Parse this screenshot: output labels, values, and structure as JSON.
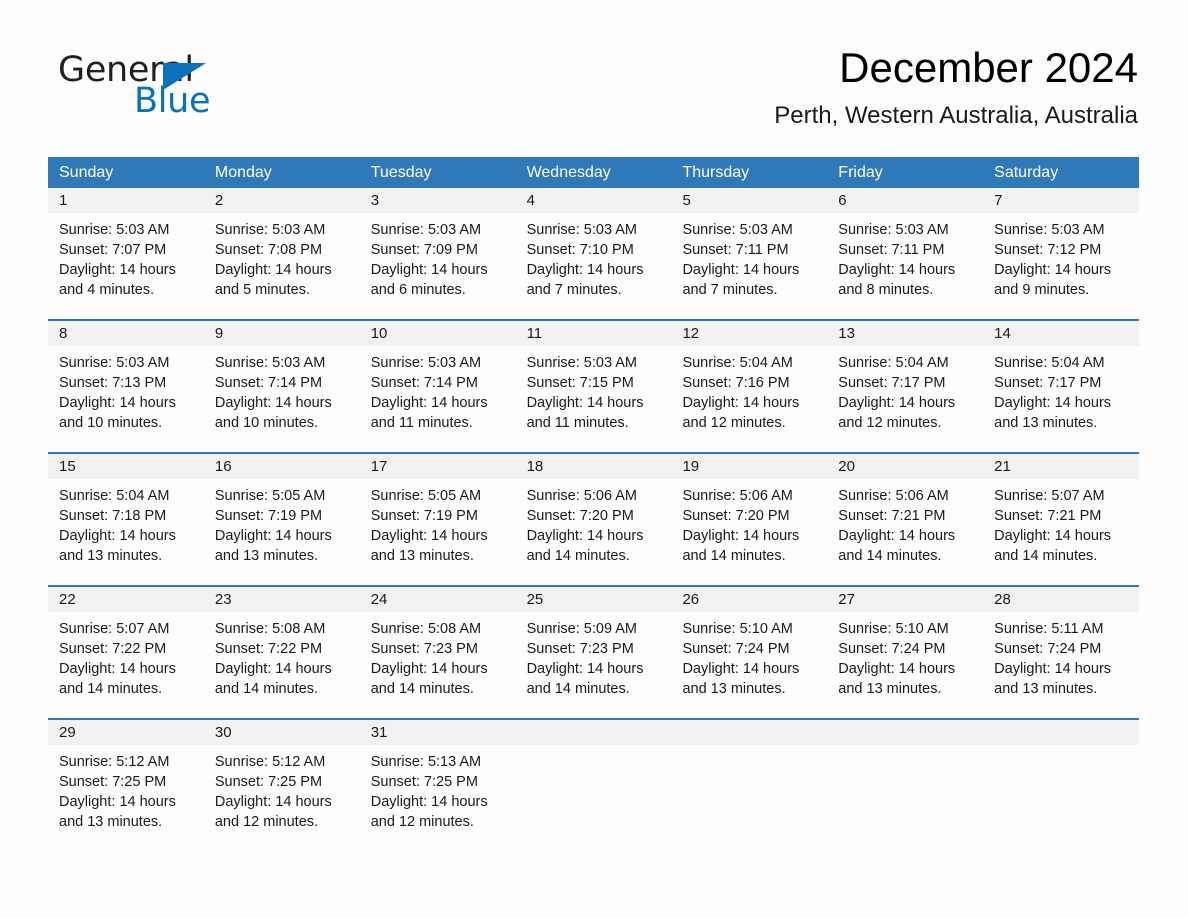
{
  "brand": {
    "name_part1": "General",
    "name_part2": "Blue",
    "triangle_color": "#0a72ba"
  },
  "header": {
    "title": "December 2024",
    "location": "Perth, Western Australia, Australia",
    "accent_color": "#3079b9",
    "band_color": "#f2f2f2"
  },
  "weekdays": [
    "Sunday",
    "Monday",
    "Tuesday",
    "Wednesday",
    "Thursday",
    "Friday",
    "Saturday"
  ],
  "weeks": [
    [
      {
        "day": "1",
        "sunrise": "Sunrise: 5:03 AM",
        "sunset": "Sunset: 7:07 PM",
        "daylight_1": "Daylight: 14 hours",
        "daylight_2": "and 4 minutes."
      },
      {
        "day": "2",
        "sunrise": "Sunrise: 5:03 AM",
        "sunset": "Sunset: 7:08 PM",
        "daylight_1": "Daylight: 14 hours",
        "daylight_2": "and 5 minutes."
      },
      {
        "day": "3",
        "sunrise": "Sunrise: 5:03 AM",
        "sunset": "Sunset: 7:09 PM",
        "daylight_1": "Daylight: 14 hours",
        "daylight_2": "and 6 minutes."
      },
      {
        "day": "4",
        "sunrise": "Sunrise: 5:03 AM",
        "sunset": "Sunset: 7:10 PM",
        "daylight_1": "Daylight: 14 hours",
        "daylight_2": "and 7 minutes."
      },
      {
        "day": "5",
        "sunrise": "Sunrise: 5:03 AM",
        "sunset": "Sunset: 7:11 PM",
        "daylight_1": "Daylight: 14 hours",
        "daylight_2": "and 7 minutes."
      },
      {
        "day": "6",
        "sunrise": "Sunrise: 5:03 AM",
        "sunset": "Sunset: 7:11 PM",
        "daylight_1": "Daylight: 14 hours",
        "daylight_2": "and 8 minutes."
      },
      {
        "day": "7",
        "sunrise": "Sunrise: 5:03 AM",
        "sunset": "Sunset: 7:12 PM",
        "daylight_1": "Daylight: 14 hours",
        "daylight_2": "and 9 minutes."
      }
    ],
    [
      {
        "day": "8",
        "sunrise": "Sunrise: 5:03 AM",
        "sunset": "Sunset: 7:13 PM",
        "daylight_1": "Daylight: 14 hours",
        "daylight_2": "and 10 minutes."
      },
      {
        "day": "9",
        "sunrise": "Sunrise: 5:03 AM",
        "sunset": "Sunset: 7:14 PM",
        "daylight_1": "Daylight: 14 hours",
        "daylight_2": "and 10 minutes."
      },
      {
        "day": "10",
        "sunrise": "Sunrise: 5:03 AM",
        "sunset": "Sunset: 7:14 PM",
        "daylight_1": "Daylight: 14 hours",
        "daylight_2": "and 11 minutes."
      },
      {
        "day": "11",
        "sunrise": "Sunrise: 5:03 AM",
        "sunset": "Sunset: 7:15 PM",
        "daylight_1": "Daylight: 14 hours",
        "daylight_2": "and 11 minutes."
      },
      {
        "day": "12",
        "sunrise": "Sunrise: 5:04 AM",
        "sunset": "Sunset: 7:16 PM",
        "daylight_1": "Daylight: 14 hours",
        "daylight_2": "and 12 minutes."
      },
      {
        "day": "13",
        "sunrise": "Sunrise: 5:04 AM",
        "sunset": "Sunset: 7:17 PM",
        "daylight_1": "Daylight: 14 hours",
        "daylight_2": "and 12 minutes."
      },
      {
        "day": "14",
        "sunrise": "Sunrise: 5:04 AM",
        "sunset": "Sunset: 7:17 PM",
        "daylight_1": "Daylight: 14 hours",
        "daylight_2": "and 13 minutes."
      }
    ],
    [
      {
        "day": "15",
        "sunrise": "Sunrise: 5:04 AM",
        "sunset": "Sunset: 7:18 PM",
        "daylight_1": "Daylight: 14 hours",
        "daylight_2": "and 13 minutes."
      },
      {
        "day": "16",
        "sunrise": "Sunrise: 5:05 AM",
        "sunset": "Sunset: 7:19 PM",
        "daylight_1": "Daylight: 14 hours",
        "daylight_2": "and 13 minutes."
      },
      {
        "day": "17",
        "sunrise": "Sunrise: 5:05 AM",
        "sunset": "Sunset: 7:19 PM",
        "daylight_1": "Daylight: 14 hours",
        "daylight_2": "and 13 minutes."
      },
      {
        "day": "18",
        "sunrise": "Sunrise: 5:06 AM",
        "sunset": "Sunset: 7:20 PM",
        "daylight_1": "Daylight: 14 hours",
        "daylight_2": "and 14 minutes."
      },
      {
        "day": "19",
        "sunrise": "Sunrise: 5:06 AM",
        "sunset": "Sunset: 7:20 PM",
        "daylight_1": "Daylight: 14 hours",
        "daylight_2": "and 14 minutes."
      },
      {
        "day": "20",
        "sunrise": "Sunrise: 5:06 AM",
        "sunset": "Sunset: 7:21 PM",
        "daylight_1": "Daylight: 14 hours",
        "daylight_2": "and 14 minutes."
      },
      {
        "day": "21",
        "sunrise": "Sunrise: 5:07 AM",
        "sunset": "Sunset: 7:21 PM",
        "daylight_1": "Daylight: 14 hours",
        "daylight_2": "and 14 minutes."
      }
    ],
    [
      {
        "day": "22",
        "sunrise": "Sunrise: 5:07 AM",
        "sunset": "Sunset: 7:22 PM",
        "daylight_1": "Daylight: 14 hours",
        "daylight_2": "and 14 minutes."
      },
      {
        "day": "23",
        "sunrise": "Sunrise: 5:08 AM",
        "sunset": "Sunset: 7:22 PM",
        "daylight_1": "Daylight: 14 hours",
        "daylight_2": "and 14 minutes."
      },
      {
        "day": "24",
        "sunrise": "Sunrise: 5:08 AM",
        "sunset": "Sunset: 7:23 PM",
        "daylight_1": "Daylight: 14 hours",
        "daylight_2": "and 14 minutes."
      },
      {
        "day": "25",
        "sunrise": "Sunrise: 5:09 AM",
        "sunset": "Sunset: 7:23 PM",
        "daylight_1": "Daylight: 14 hours",
        "daylight_2": "and 14 minutes."
      },
      {
        "day": "26",
        "sunrise": "Sunrise: 5:10 AM",
        "sunset": "Sunset: 7:24 PM",
        "daylight_1": "Daylight: 14 hours",
        "daylight_2": "and 13 minutes."
      },
      {
        "day": "27",
        "sunrise": "Sunrise: 5:10 AM",
        "sunset": "Sunset: 7:24 PM",
        "daylight_1": "Daylight: 14 hours",
        "daylight_2": "and 13 minutes."
      },
      {
        "day": "28",
        "sunrise": "Sunrise: 5:11 AM",
        "sunset": "Sunset: 7:24 PM",
        "daylight_1": "Daylight: 14 hours",
        "daylight_2": "and 13 minutes."
      }
    ],
    [
      {
        "day": "29",
        "sunrise": "Sunrise: 5:12 AM",
        "sunset": "Sunset: 7:25 PM",
        "daylight_1": "Daylight: 14 hours",
        "daylight_2": "and 13 minutes."
      },
      {
        "day": "30",
        "sunrise": "Sunrise: 5:12 AM",
        "sunset": "Sunset: 7:25 PM",
        "daylight_1": "Daylight: 14 hours",
        "daylight_2": "and 12 minutes."
      },
      {
        "day": "31",
        "sunrise": "Sunrise: 5:13 AM",
        "sunset": "Sunset: 7:25 PM",
        "daylight_1": "Daylight: 14 hours",
        "daylight_2": "and 12 minutes."
      },
      {
        "day": "",
        "sunrise": "",
        "sunset": "",
        "daylight_1": "",
        "daylight_2": ""
      },
      {
        "day": "",
        "sunrise": "",
        "sunset": "",
        "daylight_1": "",
        "daylight_2": ""
      },
      {
        "day": "",
        "sunrise": "",
        "sunset": "",
        "daylight_1": "",
        "daylight_2": ""
      },
      {
        "day": "",
        "sunrise": "",
        "sunset": "",
        "daylight_1": "",
        "daylight_2": ""
      }
    ]
  ]
}
